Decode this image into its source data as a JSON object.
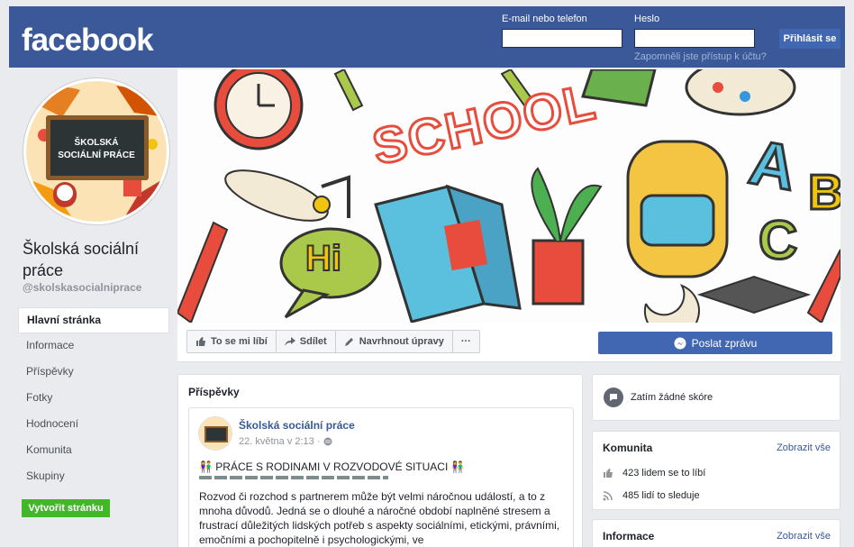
{
  "header": {
    "logo": "facebook",
    "email_label": "E-mail nebo telefon",
    "password_label": "Heslo",
    "forgot_link": "Zapomněli jste přístup k účtu?",
    "login_button": "Přihlásit se"
  },
  "page": {
    "avatar_text": "ŠKOLSKÁ SOCIÁLNÍ PRÁCE",
    "name": "Školská sociální práce",
    "handle": "@skolskasocialniprace",
    "cover_word": "SCHOOL",
    "cover_hi": "Hi"
  },
  "nav": {
    "items": [
      "Hlavní stránka",
      "Informace",
      "Příspěvky",
      "Fotky",
      "Hodnocení",
      "Komunita",
      "Skupiny"
    ],
    "create_button": "Vytvořit stránku"
  },
  "actions": {
    "like": "To se mi líbí",
    "share": "Sdílet",
    "suggest": "Navrhnout úpravy",
    "more": "···",
    "message": "Poslat zprávu"
  },
  "posts": {
    "title": "Příspěvky",
    "author": "Školská sociální práce",
    "date": "22. května v 2:13 ·",
    "headline": "👫 PRÁCE S RODINAMI V ROZVODOVÉ SITUACI 👫",
    "body": "Rozvod či rozchod s partnerem může být velmi náročnou událostí, a to z mnoha důvodů. Jedná se o dlouhé a náročné období naplněné stresem a frustrací důležitých lidských potřeb s aspekty sociálními, etickými, právními, emočními a pochopitelně i psychologickými, ve"
  },
  "rating": {
    "text": "Zatím žádné skóre"
  },
  "community": {
    "title": "Komunita",
    "see_all": "Zobrazit vše",
    "likes": "423 lidem se to líbí",
    "follows": "485 lidí to sleduje"
  },
  "info": {
    "title": "Informace",
    "see_all": "Zobrazit vše"
  },
  "colors": {
    "brand": "#3b5998",
    "button": "#4267b2",
    "green": "#42b72a",
    "link": "#385898"
  }
}
